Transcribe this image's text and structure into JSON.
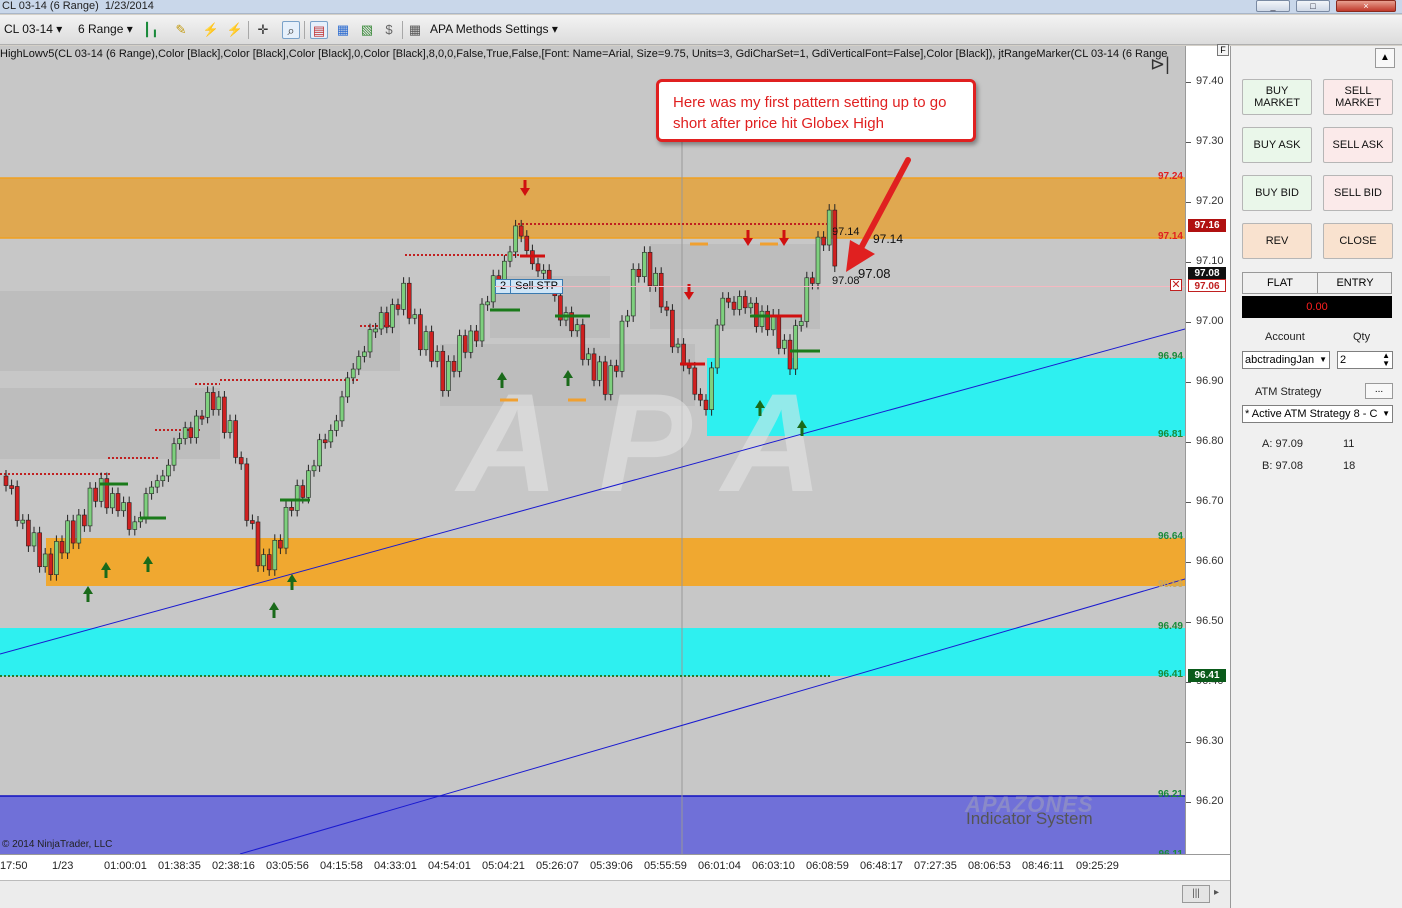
{
  "window": {
    "title": "CL 03-14 (6 Range)  1/23/2014",
    "controls": [
      "_",
      "□",
      "×"
    ]
  },
  "toolbar": {
    "instrument": "CL 03-14",
    "period": "6 Range",
    "methods_label": "APA Methods Settings"
  },
  "chart": {
    "indicator_text": "HighLowv5(CL 03-14 (6 Range),Color [Black],Color [Black],Color [Black],0,Color [Black],8,0,0,False,True,False,[Font: Name=Arial, Size=9.75, Units=3, GdiCharSet=1, GdiVerticalFont=False],Color [Black]), jtRangeMarker(CL 03-14 (6 Range",
    "order_marker": {
      "qty": "2",
      "label": "Sell STP"
    },
    "price_labels": {
      "high": "97.14",
      "mid": "97.08",
      "ask_marker": "97.14",
      "bid_marker": "97.08"
    },
    "copyright": "© 2014 NinjaTrader, LLC",
    "watermark": "APA",
    "logo": {
      "top": "APAZONES",
      "bottom": "Indicator System"
    },
    "callout": "Here was my first pattern setting up to go short after price hit Globex High",
    "zones": [
      {
        "top": "97.24",
        "bottom": "97.14",
        "color": "#e0a850",
        "label_color": "#e02020"
      },
      {
        "top": "96.94",
        "bottom": "96.81",
        "color": "#2ef0f0",
        "label_color": "#1a8a3a"
      },
      {
        "top": "96.64",
        "bottom": "96.56",
        "color": "#f0a830",
        "label_color": "#1a8a3a"
      },
      {
        "top": "96.49",
        "bottom": "96.41",
        "color": "#2ef0f0",
        "label_color": "#1a8a3a"
      },
      {
        "top": "96.21",
        "bottom": "96.11",
        "color": "#7070d8",
        "label_color": "#1a8a3a"
      }
    ]
  },
  "price_axis": {
    "ticks": [
      "97.40",
      "97.30",
      "97.20",
      "97.10",
      "97.00",
      "96.90",
      "96.80",
      "96.70",
      "96.60",
      "96.50",
      "96.40",
      "96.30",
      "96.20"
    ],
    "boxes": [
      {
        "label": "97.16",
        "color": "#b01010"
      },
      {
        "label": "97.08",
        "color": "#111111"
      },
      {
        "label": "97.06",
        "color": "#ffffff"
      },
      {
        "label": "96.41",
        "color": "#0a5a1a"
      }
    ]
  },
  "time_axis": {
    "ticks": [
      "17:50",
      "1/23",
      "01:00:01",
      "01:38:35",
      "02:38:16",
      "03:05:56",
      "04:15:58",
      "04:33:01",
      "04:54:01",
      "05:04:21",
      "05:26:07",
      "05:39:06",
      "05:55:59",
      "06:01:04",
      "06:03:10",
      "06:08:59",
      "06:48:17",
      "07:27:35",
      "08:06:53",
      "08:46:11",
      "09:25:29"
    ]
  },
  "panel": {
    "buy_market": "BUY MARKET",
    "sell_market": "SELL MARKET",
    "buy_ask": "BUY ASK",
    "sell_ask": "SELL ASK",
    "buy_bid": "BUY BID",
    "sell_bid": "SELL BID",
    "rev": "REV",
    "close": "CLOSE",
    "flat": "FLAT",
    "entry": "ENTRY",
    "pnl": "0.00",
    "account_label": "Account",
    "qty_label": "Qty",
    "account": "abctradingJan",
    "qty": "2",
    "atm_label": "ATM Strategy",
    "atm_button": "...",
    "atm_value": "* Active ATM Strategy 8 - C",
    "ask_label": "A: 97.09",
    "ask_size": "11",
    "bid_label": "B: 97.08",
    "bid_size": "18"
  }
}
